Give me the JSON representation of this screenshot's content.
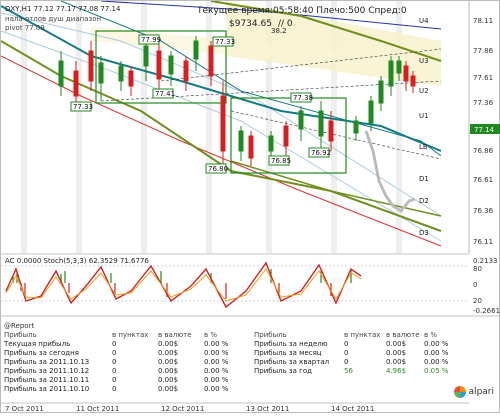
{
  "header": {
    "symbol_line": "DXY,H1  77.12 77.17 77.08 77.14",
    "overlay_1": "нала отлов душ диапазон",
    "overlay_2": "pivot 77.09",
    "current_time_label": "Текущее время:05:58:40 Плечо:500 Спред:0",
    "balance_label": "$9734.65",
    "zero_label": "// 0"
  },
  "levels": {
    "u4": "U4",
    "u3": "U3",
    "u2": "U2",
    "u1": "U1",
    "lb": "LB",
    "d1": "D1",
    "d2": "D2",
    "d3": "D3",
    "top_value": "38.2"
  },
  "price_axis": {
    "labels": [
      "78.11",
      "77.86",
      "77.61",
      "77.36",
      "77.11",
      "76.86",
      "76.61",
      "76.36",
      "76.11"
    ],
    "current_price": "77.14"
  },
  "box_labels": [
    "77.99",
    "77.41",
    "77.33",
    "77.33",
    "76.80",
    "76.85",
    "76.92",
    "77.38"
  ],
  "indicator": {
    "label": "AC 0.0000  Stoch(5,3,3) 62.3529 71.6776",
    "axis": [
      "0.2133",
      "80",
      "20",
      "0",
      "-0.2661"
    ]
  },
  "time_axis": [
    "7 Oct 2011",
    "11 Oct 2011",
    "12 Oct 2011",
    "13 Oct 2011",
    "14 Oct 2011"
  ],
  "report": {
    "title": "@Report",
    "left": {
      "headers": [
        "Прибыль",
        "в пунктах",
        "в валюте",
        "в %"
      ],
      "rows": [
        [
          "Текущая прибыль",
          "0",
          "0.00$",
          "0.00 %"
        ],
        [
          "Прибыль за сегодня",
          "0",
          "0.00$",
          "0.00 %"
        ],
        [
          "Прибыль за 2011.10.13",
          "0",
          "0.00$",
          "0.00 %"
        ],
        [
          "Прибыль за 2011.10.12",
          "0",
          "0.00$",
          "0.00 %"
        ],
        [
          "Прибыль за 2011.10.11",
          "0",
          "0.00$",
          "0.00 %"
        ],
        [
          "Прибыль за 2011.10.10",
          "0",
          "0.00$",
          "0.00 %"
        ]
      ]
    },
    "right": {
      "headers": [
        "Прибыль",
        "в пунктах",
        "в валюте",
        "в %"
      ],
      "rows": [
        [
          "Прибыль за неделю",
          "0",
          "0.00$",
          "0.00 %"
        ],
        [
          "Прибыль за месяц",
          "0",
          "0.00$",
          "0.00 %"
        ],
        [
          "Прибыль за квартал",
          "0",
          "0.00$",
          "0.00 %"
        ],
        [
          "Прибыль за год",
          "56",
          "4.96$",
          "0.05 %"
        ]
      ]
    }
  },
  "brand": {
    "name": "alpari"
  },
  "colors": {
    "candle_up": "#1f8a1f",
    "candle_down": "#d62020",
    "channel": "#6f8f1f",
    "teal": "#157a85",
    "red_ma": "#e03030"
  }
}
